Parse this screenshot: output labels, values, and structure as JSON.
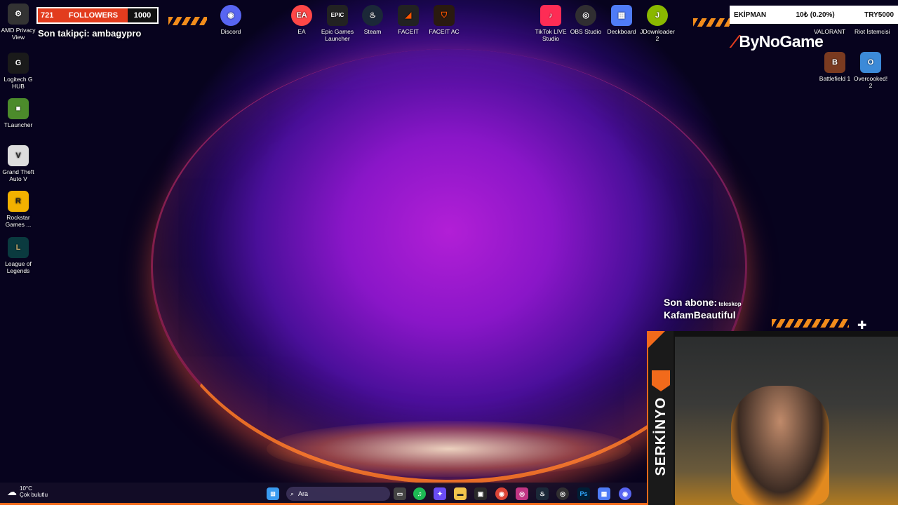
{
  "overlay": {
    "followers_count": "721",
    "followers_label": "FOLLOWERS",
    "followers_goal": "1000",
    "last_follower": "Son takipçi: ambagypro",
    "brand": "ByNoGame",
    "team_label": "EKİPMAN",
    "stat_mid": "10₺ (0.20%)",
    "stat_right": "TRY5000",
    "last_sub_label": "Son abone:",
    "last_sub_extra": "teleskop",
    "last_sub_name": "KafamBeautiful",
    "streamer_name": "SERKİNYO"
  },
  "desktop_left": [
    {
      "label": "AMD Privacy View",
      "icon": "settings-icon"
    },
    {
      "label": "Logitech G HUB",
      "icon": "logitech-icon"
    },
    {
      "label": "TLauncher",
      "icon": "minecraft-icon"
    },
    {
      "label": "Grand Theft Auto V",
      "icon": "gta-icon"
    },
    {
      "label": "Rockstar Games ...",
      "icon": "rockstar-icon"
    },
    {
      "label": "League of Legends",
      "icon": "lol-icon"
    }
  ],
  "desktop_top": [
    {
      "label": "Discord",
      "icon": "discord-icon"
    },
    {
      "label": "EA",
      "icon": "ea-icon"
    },
    {
      "label": "Epic Games Launcher",
      "icon": "epic-icon"
    },
    {
      "label": "Steam",
      "icon": "steam-icon"
    },
    {
      "label": "FACEIT",
      "icon": "faceit-icon"
    },
    {
      "label": "FACEIT AC",
      "icon": "faceit-ac-icon"
    },
    {
      "label": "TikTok LIVE Studio",
      "icon": "tiktok-icon"
    },
    {
      "label": "OBS Studio",
      "icon": "obs-icon"
    },
    {
      "label": "Deckboard",
      "icon": "deckboard-icon"
    },
    {
      "label": "JDownloader 2",
      "icon": "jdownloader-icon"
    }
  ],
  "desktop_right": [
    {
      "label": "VALORANT",
      "icon": "valorant-icon"
    },
    {
      "label": "Riot İstemcisi",
      "icon": "riot-icon"
    },
    {
      "label": "Battlefield 1",
      "icon": "battlefield-icon"
    },
    {
      "label": "Overcooked! 2",
      "icon": "overcooked-icon"
    }
  ],
  "taskbar": {
    "weather_temp": "10°C",
    "weather_desc": "Çok bulutlu",
    "search_placeholder": "Ara"
  },
  "colors": {
    "accent": "#f26a1b",
    "discord": "#5865f2",
    "steam": "#1b2838"
  }
}
